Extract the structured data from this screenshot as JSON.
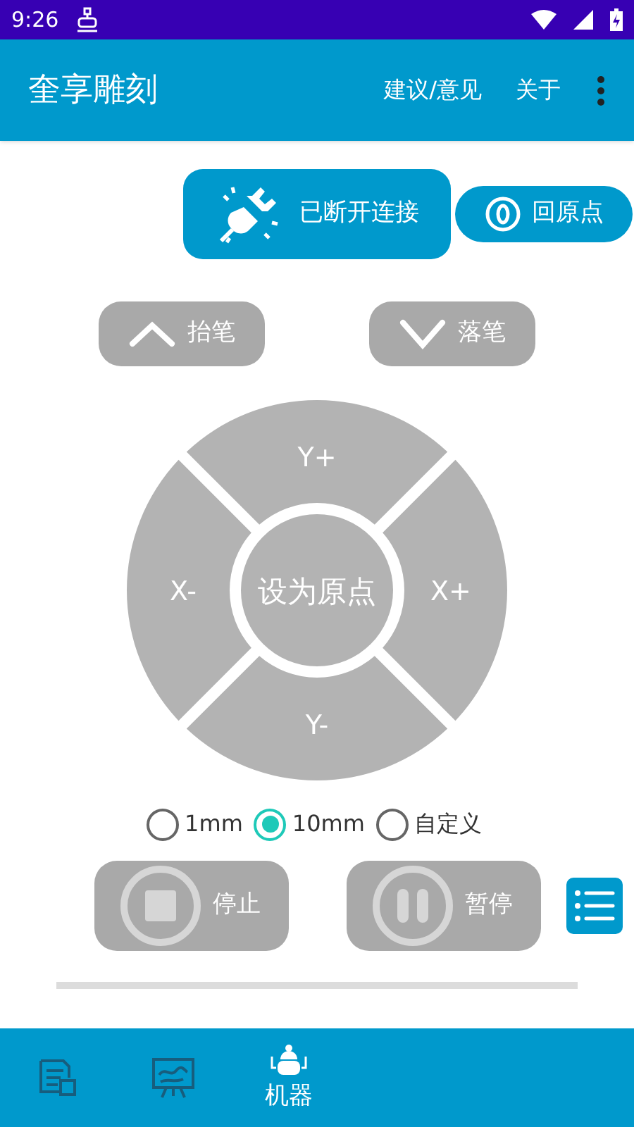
{
  "status_bar": {
    "time": "9:26"
  },
  "app_bar": {
    "title": "奎享雕刻",
    "actions": [
      "建议/意见",
      "关于"
    ]
  },
  "connection": {
    "label": "已断开连接",
    "connected": false
  },
  "home_button": {
    "label": "回原点"
  },
  "pen_buttons": [
    {
      "kind": "up",
      "label": "抬笔"
    },
    {
      "kind": "down",
      "label": "落笔"
    }
  ],
  "joystick": {
    "center": "设为原点",
    "segments": [
      {
        "kind": "up",
        "label": "Y+"
      },
      {
        "kind": "left",
        "label": "X-"
      },
      {
        "kind": "right",
        "label": "X+"
      },
      {
        "kind": "down",
        "label": "Y-"
      }
    ]
  },
  "step_options": [
    {
      "label": "1mm",
      "selected": false
    },
    {
      "label": "10mm",
      "selected": true
    },
    {
      "label": "自定义",
      "selected": false
    }
  ],
  "controls": [
    {
      "kind": "stop",
      "label": "停止"
    },
    {
      "kind": "pause",
      "label": "暂停"
    }
  ],
  "bottom_nav": [
    {
      "kind": "document",
      "selected": false
    },
    {
      "kind": "picture",
      "selected": false
    },
    {
      "kind": "machine",
      "label": "机器",
      "selected": true
    }
  ]
}
